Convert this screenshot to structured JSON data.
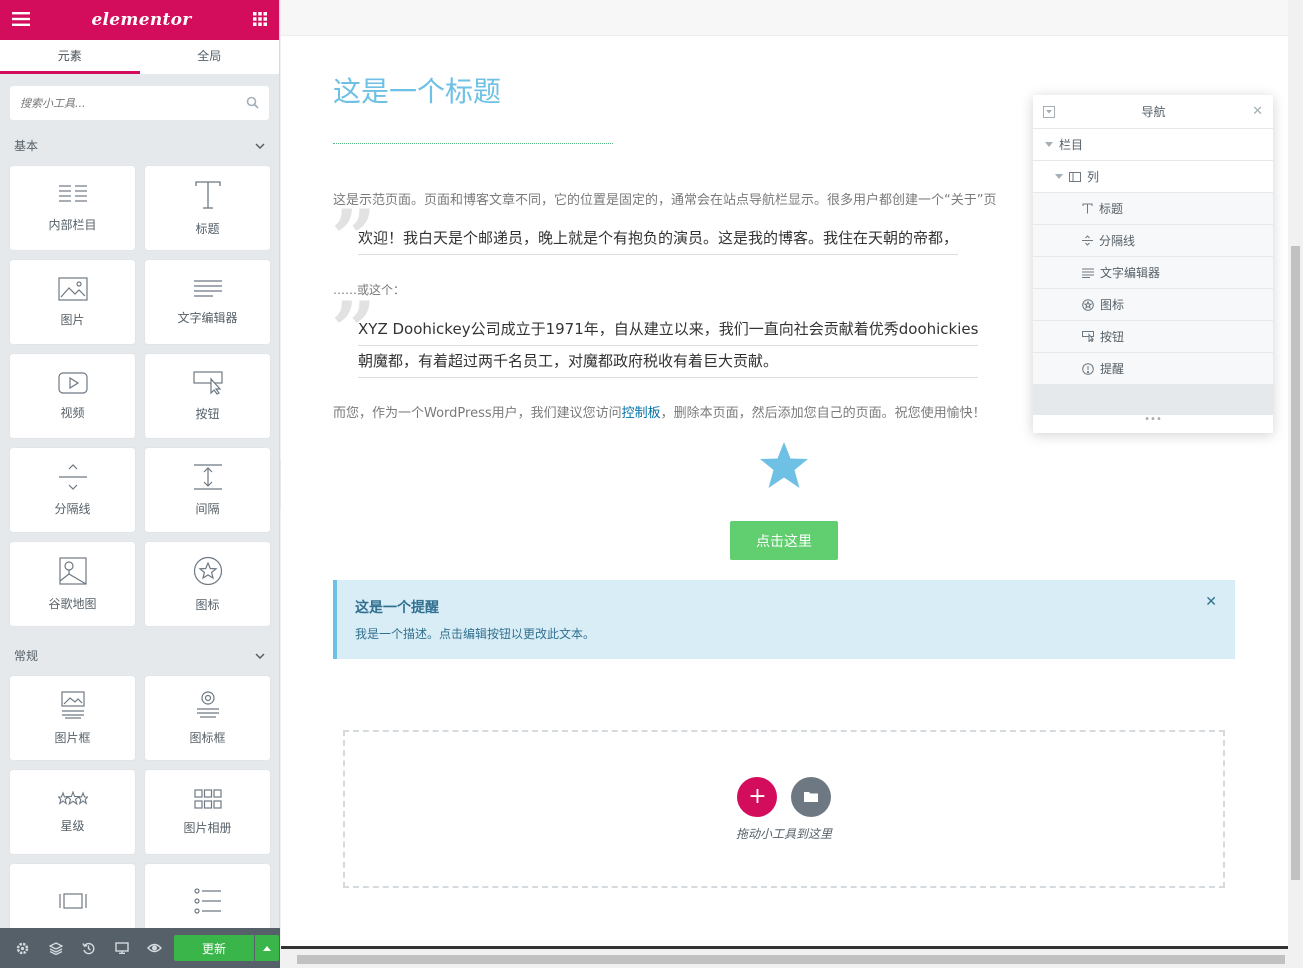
{
  "panel": {
    "logo": "elementor",
    "tabs": [
      "元素",
      "全局"
    ],
    "search_placeholder": "搜索小工具...",
    "categories": [
      {
        "name": "基本",
        "widgets": [
          {
            "label": "内部栏目",
            "icon": "inner-section-icon"
          },
          {
            "label": "标题",
            "icon": "heading-icon"
          },
          {
            "label": "图片",
            "icon": "image-icon"
          },
          {
            "label": "文字编辑器",
            "icon": "text-editor-icon"
          },
          {
            "label": "视频",
            "icon": "video-icon"
          },
          {
            "label": "按钮",
            "icon": "button-icon"
          },
          {
            "label": "分隔线",
            "icon": "divider-icon"
          },
          {
            "label": "间隔",
            "icon": "spacer-icon"
          },
          {
            "label": "谷歌地图",
            "icon": "map-icon"
          },
          {
            "label": "图标",
            "icon": "star-icon"
          }
        ]
      },
      {
        "name": "常规",
        "widgets": [
          {
            "label": "图片框",
            "icon": "image-box-icon"
          },
          {
            "label": "图标框",
            "icon": "icon-box-icon"
          },
          {
            "label": "星级",
            "icon": "star-rating-icon"
          },
          {
            "label": "图片相册",
            "icon": "gallery-icon"
          },
          {
            "label": "",
            "icon": "carousel-icon"
          },
          {
            "label": "",
            "icon": "icon-list-icon"
          }
        ]
      }
    ],
    "footer": {
      "update_label": "更新"
    }
  },
  "page": {
    "title": "这是一个标题",
    "intro": "这是示范页面。页面和博客文章不同，它的位置是固定的，通常会在站点导航栏显示。很多用户都创建一个“关于”页",
    "quote1": "欢迎！我白天是个邮递员，晚上就是个有抱负的演员。这是我的博客。我住在天朝的帝都，",
    "or_text": "……或这个：",
    "quote2_line1": "XYZ Doohickey公司成立于1971年，自从建立以来，我们一直向社会贡献着优秀doohickies",
    "quote2_line2": "朝魔都，有着超过两千名员工，对魔都政府税收有着巨大贡献。",
    "outro_before": "而您，作为一个WordPress用户，我们建议您访问",
    "outro_link": "控制板",
    "outro_after": "，删除本页面，然后添加您自己的页面。祝您使用愉快！",
    "button_label": "点击这里",
    "alert": {
      "title": "这是一个提醒",
      "description": "我是一个描述。点击编辑按钮以更改此文本。"
    },
    "drop_text": "拖动小工具到这里"
  },
  "navigator": {
    "title": "导航",
    "items": [
      {
        "label": "栏目",
        "icon": "caret-down-icon",
        "level": 0
      },
      {
        "label": "列",
        "icon": "column-icon",
        "level": 1
      },
      {
        "label": "标题",
        "icon": "heading-icon",
        "level": 2
      },
      {
        "label": "分隔线",
        "icon": "divider-icon",
        "level": 2
      },
      {
        "label": "文字编辑器",
        "icon": "text-editor-icon",
        "level": 2
      },
      {
        "label": "图标",
        "icon": "star-icon",
        "level": 2
      },
      {
        "label": "按钮",
        "icon": "button-icon",
        "level": 2
      },
      {
        "label": "提醒",
        "icon": "alert-icon",
        "level": 2
      }
    ]
  },
  "colors": {
    "brand": "#d30c5c",
    "accent": "#6ec1e4",
    "button": "#61ce70",
    "update": "#39b54a"
  }
}
